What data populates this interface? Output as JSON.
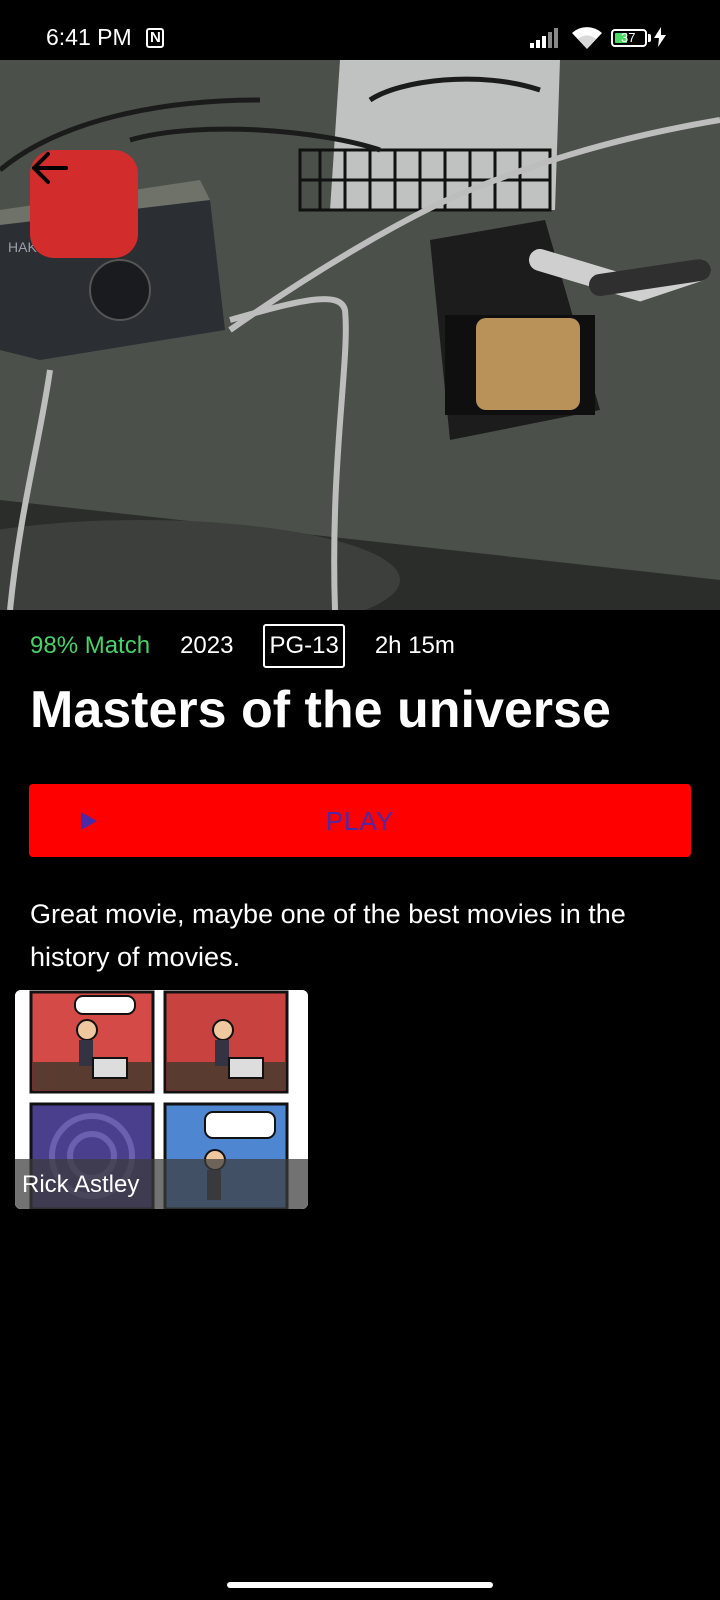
{
  "status_bar": {
    "time": "6:41 PM",
    "battery": "37",
    "icons": [
      "nfc-icon",
      "signal-icon",
      "wifi-icon",
      "battery-icon",
      "charging-icon"
    ]
  },
  "hero": {
    "back_icon": "arrow-left-icon",
    "back_button_color": "#d32c2c"
  },
  "movie": {
    "match": "98% Match",
    "year": "2023",
    "rating": "PG-13",
    "duration": "2h 15m",
    "title": "Masters of the universe",
    "description": "Great movie, maybe one of the best movies in the history of movies."
  },
  "play_button": {
    "label": "PLAY",
    "icon": "play-icon",
    "color": "#ff0000"
  },
  "cast": [
    {
      "name": "Rick Astley",
      "image": "comic-strip-image"
    }
  ],
  "colors": {
    "background": "#000000",
    "match": "#46d369",
    "accent": "#ff0000"
  }
}
